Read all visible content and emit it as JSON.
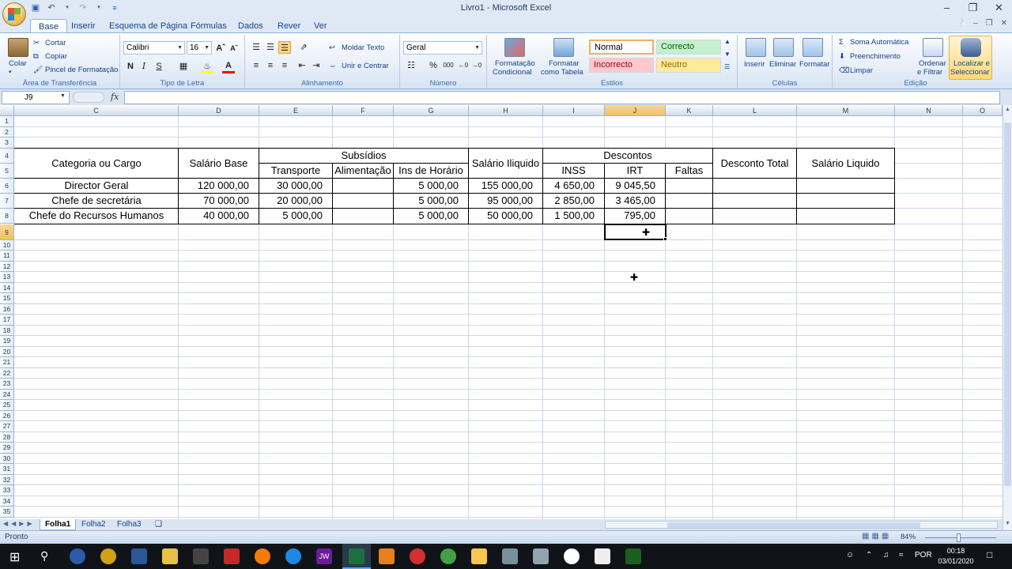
{
  "window": {
    "title": "Livro1 - Microsoft Excel"
  },
  "tabs": [
    {
      "label": "Base"
    },
    {
      "label": "Inserir"
    },
    {
      "label": "Esquema de Página"
    },
    {
      "label": "Fórmulas"
    },
    {
      "label": "Dados"
    },
    {
      "label": "Rever"
    },
    {
      "label": "Ver"
    }
  ],
  "ribbon": {
    "clipboard": {
      "paste": "Colar",
      "cut": "Cortar",
      "copy": "Copiar",
      "format_painter": "Pincel de Formatação",
      "label": "Área de Transferência"
    },
    "font": {
      "name": "Calibri",
      "size": "16",
      "bold": "N",
      "italic": "I",
      "underline": "S",
      "font_color_letter": "A",
      "label": "Tipo de Letra"
    },
    "alignment": {
      "wrap": "Moldar Texto",
      "merge": "Unir e Centrar",
      "label": "Alinhamento"
    },
    "number": {
      "format": "Geral",
      "percent": "%",
      "thousands": "000",
      "label": "Número"
    },
    "styles": {
      "cond_format": "Formatação",
      "cond_format2": "Condicional",
      "table_format": "Formatar",
      "table_format2": "como Tabela",
      "normal": "Normal",
      "correct": "Correcto",
      "incorrect": "Incorrecto",
      "neutral": "Neutro",
      "label": "Estilos"
    },
    "cells": {
      "insert": "Inserir",
      "delete": "Eliminar",
      "format": "Formatar",
      "label": "Células"
    },
    "editing": {
      "autosum": "Soma Automática",
      "fill": "Preenchimento",
      "clear": "Limpar",
      "sort": "Ordenar",
      "sort2": "e Filtrar",
      "find": "Localizar e",
      "find2": "Seleccionar",
      "label": "Edição"
    }
  },
  "formula_bar": {
    "name_box": "J9",
    "fx": "fx",
    "value": ""
  },
  "columns": [
    "C",
    "D",
    "E",
    "F",
    "G",
    "H",
    "I",
    "J",
    "K",
    "L",
    "M",
    "N",
    "O"
  ],
  "rows": [
    "1",
    "2",
    "3",
    "4",
    "5",
    "6",
    "7",
    "8",
    "9",
    "10",
    "11",
    "12",
    "13",
    "14",
    "15",
    "16",
    "17",
    "18",
    "19",
    "20",
    "21",
    "22",
    "23",
    "24",
    "25",
    "26",
    "27",
    "28",
    "29",
    "30",
    "31",
    "32",
    "33",
    "34",
    "35"
  ],
  "table": {
    "h_category": "Categoria ou Cargo",
    "h_base": "Salário Base",
    "h_subsidies": "Subsídios",
    "h_transport": "Transporte",
    "h_food": "Alimentação",
    "h_schedule": "Ins de Horário",
    "h_gross": "Salário Iliquido",
    "h_discounts": "Descontos",
    "h_inss": "INSS",
    "h_irt": "IRT",
    "h_absences": "Faltas",
    "h_total_discount": "Desconto Total",
    "h_net": "Salário Liquido",
    "data_rows": [
      {
        "category": "Director Geral",
        "base": "120 000,00",
        "transport": "30 000,00",
        "food": "",
        "schedule": "5 000,00",
        "gross": "155 000,00",
        "inss": "4 650,00",
        "irt": "9 045,50",
        "absences": "",
        "total": "",
        "net": ""
      },
      {
        "category": "Chefe de secretária",
        "base": "70 000,00",
        "transport": "20 000,00",
        "food": "",
        "schedule": "5 000,00",
        "gross": "95 000,00",
        "inss": "2 850,00",
        "irt": "3 465,00",
        "absences": "",
        "total": "",
        "net": ""
      },
      {
        "category": "Chefe do Recursos Humanos",
        "base": "40 000,00",
        "transport": "5 000,00",
        "food": "",
        "schedule": "5 000,00",
        "gross": "50 000,00",
        "inss": "1 500,00",
        "irt": "795,00",
        "absences": "",
        "total": "",
        "net": ""
      }
    ]
  },
  "sheets": [
    {
      "label": "Folha1"
    },
    {
      "label": "Folha2"
    },
    {
      "label": "Folha3"
    }
  ],
  "status": {
    "ready": "Pronto",
    "zoom": "84%"
  },
  "taskbar": {
    "lang": "POR",
    "time": "00:18",
    "date": "03/01/2020",
    "jw_label": "JW"
  }
}
